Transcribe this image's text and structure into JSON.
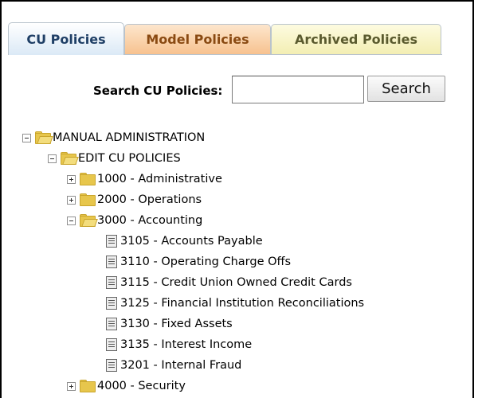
{
  "tabs": [
    {
      "label": "CU Policies",
      "active": true
    },
    {
      "label": "Model Policies",
      "active": false
    },
    {
      "label": "Archived Policies",
      "active": false
    }
  ],
  "search": {
    "label": "Search CU Policies:",
    "value": "",
    "placeholder": "",
    "button_label": "Search"
  },
  "tree": {
    "root": {
      "label": "MANUAL ADMINISTRATION",
      "expanded": true
    },
    "edit": {
      "label": "EDIT CU POLICIES",
      "expanded": true
    },
    "folders": [
      {
        "label": "1000 - Administrative",
        "expanded": false
      },
      {
        "label": "2000 - Operations",
        "expanded": false
      },
      {
        "label": "3000 - Accounting",
        "expanded": true
      },
      {
        "label": "4000 - Security",
        "expanded": false
      }
    ],
    "documents": [
      {
        "label": "3105 - Accounts Payable"
      },
      {
        "label": "3110 - Operating Charge Offs"
      },
      {
        "label": "3115 - Credit Union Owned Credit Cards"
      },
      {
        "label": "3125 - Financial Institution Reconciliations"
      },
      {
        "label": "3130 - Fixed Assets"
      },
      {
        "label": "3135 - Interest Income"
      },
      {
        "label": "3201 - Internal Fraud"
      }
    ]
  },
  "colors": {
    "tab_cu": "#dbe9f6",
    "tab_model": "#f7c28f",
    "tab_archived": "#f3eeb3",
    "folder": "#e7c64c"
  },
  "icons": {
    "expand": "plus-box-icon",
    "collapse": "minus-box-icon",
    "folder_closed": "folder-icon",
    "folder_open": "open-folder-icon",
    "document": "document-icon"
  }
}
